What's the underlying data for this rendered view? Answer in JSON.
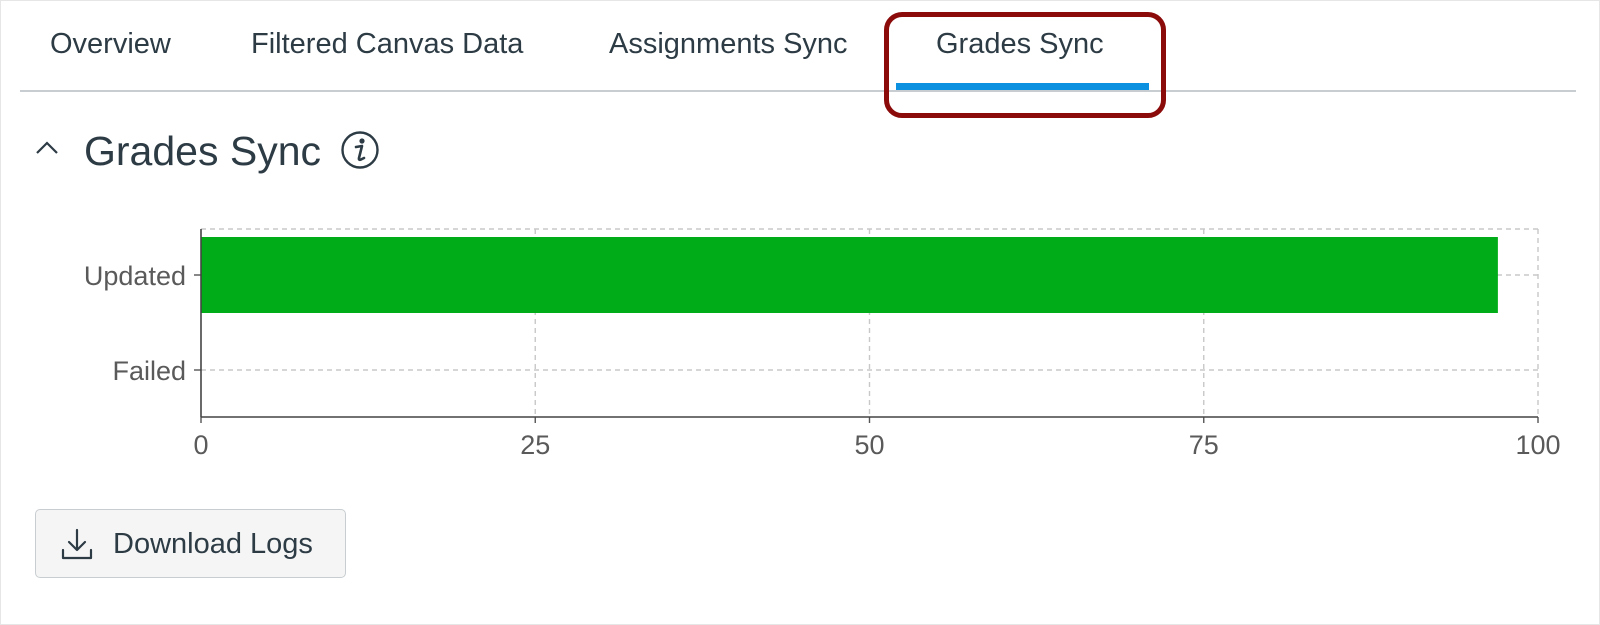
{
  "tabs": [
    {
      "label": "Overview"
    },
    {
      "label": "Filtered Canvas Data"
    },
    {
      "label": "Assignments Sync"
    },
    {
      "label": "Grades Sync",
      "active": true
    }
  ],
  "section": {
    "title": "Grades Sync",
    "collapse_icon": "chevron-up-icon",
    "info_icon": "info-icon"
  },
  "chart_data": {
    "type": "bar",
    "orientation": "horizontal",
    "categories": [
      "Updated",
      "Failed"
    ],
    "values": [
      97,
      0
    ],
    "xlim": [
      0,
      100
    ],
    "xticks": [
      "0",
      "25",
      "50",
      "75",
      "100"
    ],
    "grid": true,
    "bar_color": "#00ad18"
  },
  "actions": {
    "download_label": "Download Logs",
    "download_icon": "download-icon"
  },
  "colors": {
    "accent": "#0b91e0",
    "highlight": "#8b0b0b",
    "text": "#2d3b45"
  }
}
